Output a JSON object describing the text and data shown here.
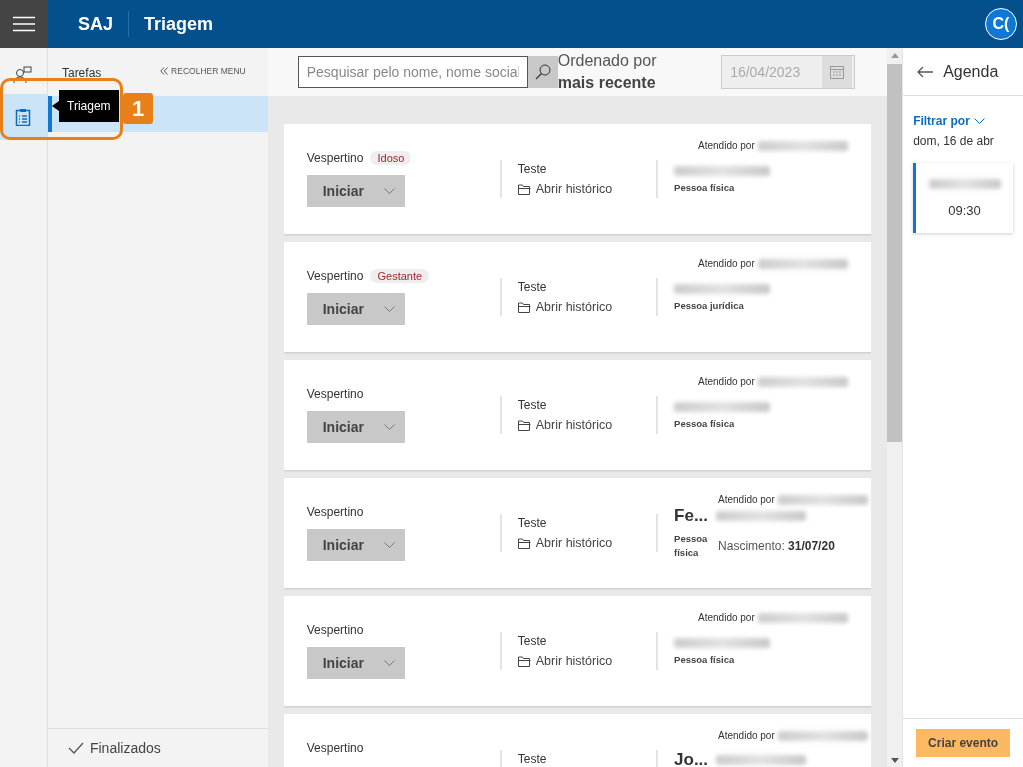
{
  "header": {
    "brand": "SAJ",
    "title": "Triagem",
    "avatar": "C("
  },
  "rail": [
    {
      "kind": "person",
      "selected": false
    },
    {
      "kind": "clipboard",
      "selected": true
    }
  ],
  "sidebar": {
    "title": "Tarefas",
    "collapse": "RECOLHER MENU",
    "items": [
      {
        "selected": true
      }
    ],
    "footer": "Finalizados"
  },
  "tooltip": {
    "text": "Triagem"
  },
  "callout": {
    "number": "1"
  },
  "toolbar": {
    "search_placeholder": "Pesquisar pelo nome, nome social",
    "sort_label": "Ordenado por",
    "sort_value": "mais recente",
    "date": {
      "value": "16/04/2023",
      "disabled": true
    }
  },
  "cards": [
    {
      "shift": "Vespertino",
      "tag": "Idoso",
      "action": "Iniciar",
      "service": "Teste",
      "history": "Abrir histórico",
      "attended_by": "Atendido por",
      "person_type": "Pessoa física"
    },
    {
      "shift": "Vespertino",
      "tag": "Gestante",
      "action": "Iniciar",
      "service": "Teste",
      "history": "Abrir histórico",
      "attended_by": "Atendido por",
      "person_type": "Pessoa jurídica"
    },
    {
      "shift": "Vespertino",
      "action": "Iniciar",
      "service": "Teste",
      "history": "Abrir histórico",
      "attended_by": "Atendido por",
      "person_type": "Pessoa física"
    },
    {
      "shift": "Vespertino",
      "action": "Iniciar",
      "service": "Teste",
      "history": "Abrir histórico",
      "attended_by": "Atendido por",
      "name": "Fe...",
      "person_type": "Pessoa física",
      "birth_label": "Nascimento:",
      "birth_date": "31/07/20"
    },
    {
      "shift": "Vespertino",
      "action": "Iniciar",
      "service": "Teste",
      "history": "Abrir histórico",
      "attended_by": "Atendido por",
      "person_type": "Pessoa física"
    },
    {
      "shift": "Vespertino",
      "service": "Teste",
      "attended_by": "Atendido por",
      "name": "Jo..."
    }
  ],
  "agenda": {
    "title": "Agenda",
    "filter": "Filtrar por",
    "date": "dom, 16 de abr",
    "events": [
      {
        "time": "09:30"
      }
    ],
    "create": "Criar evento"
  }
}
